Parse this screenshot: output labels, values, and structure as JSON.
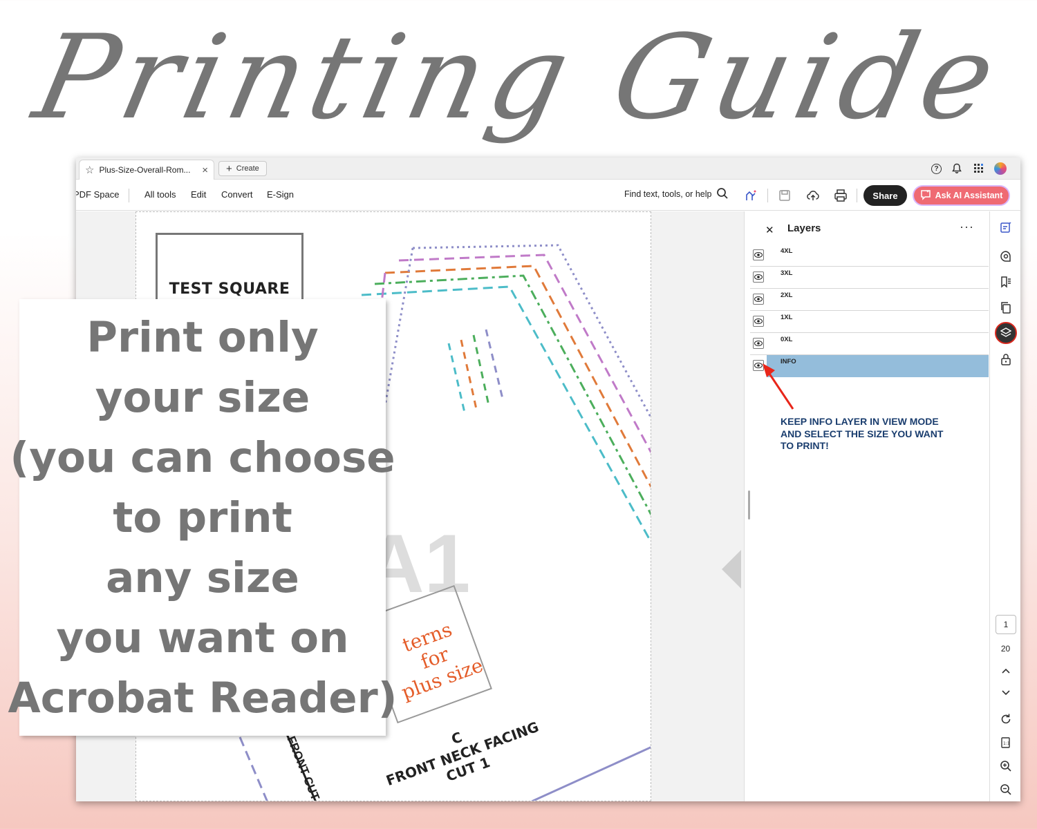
{
  "heading": "Printing Guide",
  "callout": {
    "lines": [
      "Print only",
      "your size",
      "(you can choose",
      "to print",
      "any size",
      "you want on",
      "Acrobat Reader)"
    ]
  },
  "app": {
    "tab_title": "Plus-Size-Overall-Rom...",
    "create_label": "Create",
    "menu": {
      "pdf_space": "PDF Space",
      "all_tools": "All tools",
      "edit": "Edit",
      "convert": "Convert",
      "esign": "E-Sign"
    },
    "search_label": "Find text, tools, or help",
    "share_label": "Share",
    "ai_label": "Ask AI Assistant",
    "brand_colors": {
      "share": "#222222",
      "ai": "#ef6a73",
      "selected_layer": "#94bddb",
      "note": "#1a3d6e"
    }
  },
  "document": {
    "test_square_label": "TEST SQUARE",
    "piece_big_letter": "A1",
    "logo_lines": [
      "terns",
      "for",
      "plus size"
    ],
    "facing_lines": [
      "C",
      "FRONT NECK FACING",
      "CUT 1"
    ],
    "cut_label": "FRONT CUT O"
  },
  "layers_panel": {
    "title": "Layers",
    "items": [
      {
        "name": "4XL",
        "visible": true,
        "selected": false
      },
      {
        "name": "3XL",
        "visible": true,
        "selected": false
      },
      {
        "name": "2XL",
        "visible": true,
        "selected": false
      },
      {
        "name": "1XL",
        "visible": true,
        "selected": false
      },
      {
        "name": "0XL",
        "visible": true,
        "selected": false
      },
      {
        "name": "INFO",
        "visible": true,
        "selected": true
      }
    ],
    "note_lines": [
      "KEEP INFO LAYER IN VIEW MODE",
      "AND SELECT THE SIZE YOU WANT",
      "TO PRINT!"
    ]
  },
  "page_nav": {
    "current": "1",
    "total": "20"
  }
}
